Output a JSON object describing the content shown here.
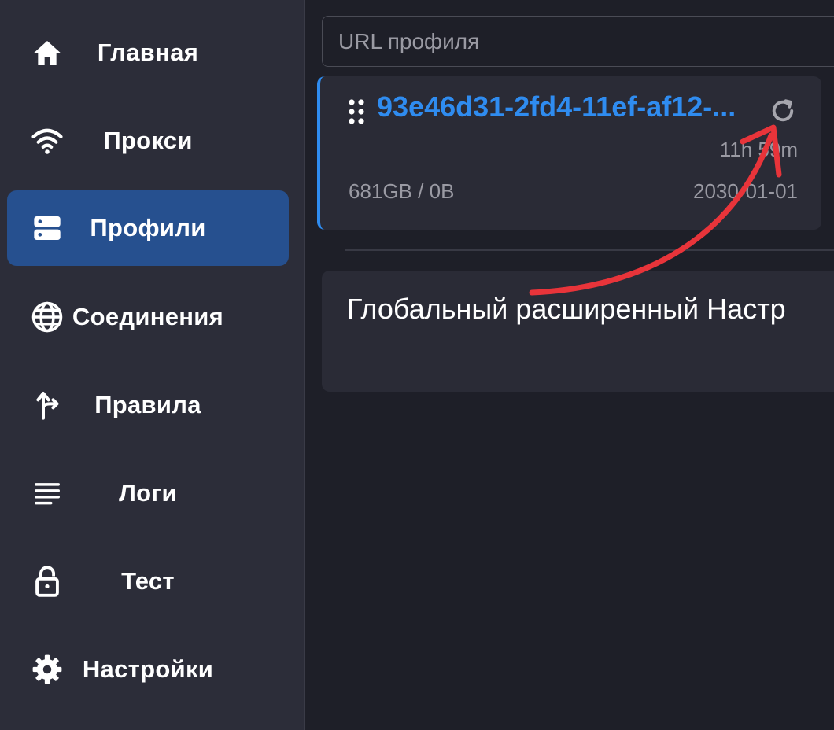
{
  "sidebar": {
    "items": [
      {
        "label": "Главная",
        "icon": "home-icon",
        "active": false
      },
      {
        "label": "Прокси",
        "icon": "wifi-icon",
        "active": false
      },
      {
        "label": "Профили",
        "icon": "server-icon",
        "active": true
      },
      {
        "label": "Соединения",
        "icon": "globe-icon",
        "active": false
      },
      {
        "label": "Правила",
        "icon": "route-icon",
        "active": false
      },
      {
        "label": "Логи",
        "icon": "lines-icon",
        "active": false
      },
      {
        "label": "Тест",
        "icon": "unlock-icon",
        "active": false
      },
      {
        "label": "Настройки",
        "icon": "gear-icon",
        "active": false
      }
    ]
  },
  "main": {
    "url_input": {
      "placeholder": "URL профиля",
      "value": ""
    },
    "profile": {
      "name": "93e46d31-2fd4-11ef-af12-...",
      "updated": "11h 59m",
      "usage": "681GB / 0B",
      "expire": "2030-01-01"
    },
    "settings_card": {
      "title": "Глобальный расширенный Настр"
    }
  },
  "colors": {
    "accent": "#2f8cf0",
    "active_nav": "#26508f",
    "annotation_arrow": "#e8343a"
  }
}
